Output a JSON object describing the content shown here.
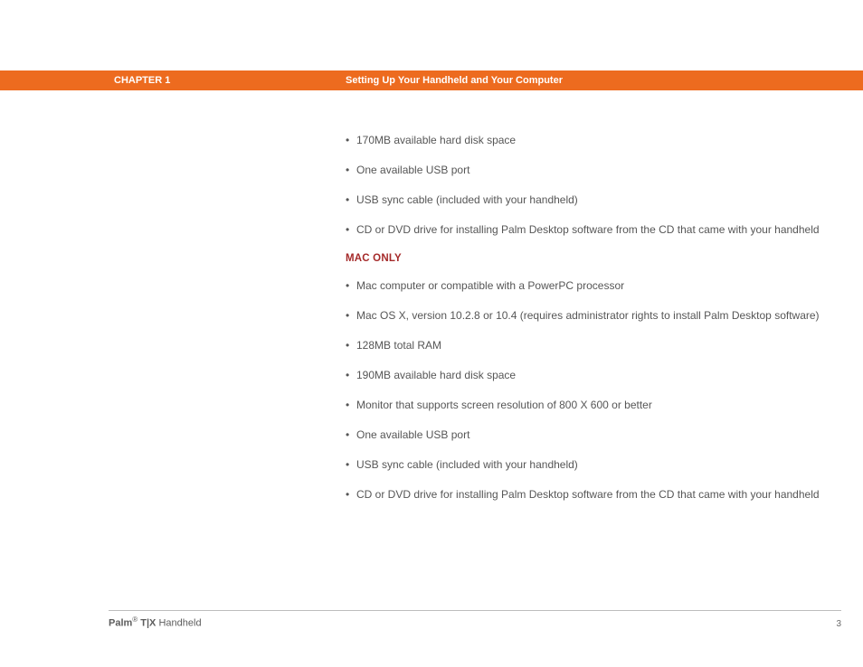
{
  "header": {
    "chapter": "CHAPTER 1",
    "title": "Setting Up Your Handheld and Your Computer"
  },
  "content": {
    "list1": [
      "170MB available hard disk space",
      "One available USB port",
      "USB sync cable (included with your handheld)",
      "CD or DVD drive for installing Palm Desktop software from the CD that came with your handheld"
    ],
    "section_heading": "MAC ONLY",
    "list2": [
      "Mac computer or compatible with a PowerPC processor",
      "Mac OS X, version 10.2.8 or 10.4 (requires administrator rights to install Palm Desktop software)",
      "128MB total RAM",
      "190MB available hard disk space",
      "Monitor that supports screen resolution of 800 X 600 or better",
      "One available USB port",
      "USB sync cable (included with your handheld)",
      "CD or DVD drive for installing Palm Desktop software from the CD that came with your handheld"
    ]
  },
  "footer": {
    "brand_bold1": "Palm",
    "registered": "®",
    "brand_bold2": " T|X",
    "brand_rest": " Handheld",
    "page": "3"
  }
}
